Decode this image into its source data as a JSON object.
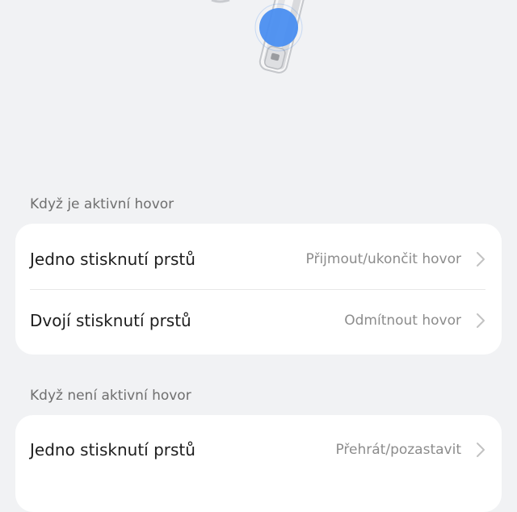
{
  "section_active": {
    "header": "Když je aktivní hovor",
    "rows": [
      {
        "title": "Jedno stisknutí prstů",
        "value": "Přijmout/ukončit hovor"
      },
      {
        "title": "Dvojí stisknutí prstů",
        "value": "Odmítnout hovor"
      }
    ]
  },
  "section_inactive": {
    "header": "Když není aktivní hovor",
    "rows": [
      {
        "title": "Jedno stisknutí prstů",
        "value": "Přehrát/pozastavit"
      }
    ]
  },
  "colors": {
    "background": "#f1f2f4",
    "card": "#ffffff",
    "accent_touch": "#4a8ef0"
  },
  "icons": [
    "earbud-illustration",
    "touch-point-icon",
    "chevron-right-icon"
  ]
}
